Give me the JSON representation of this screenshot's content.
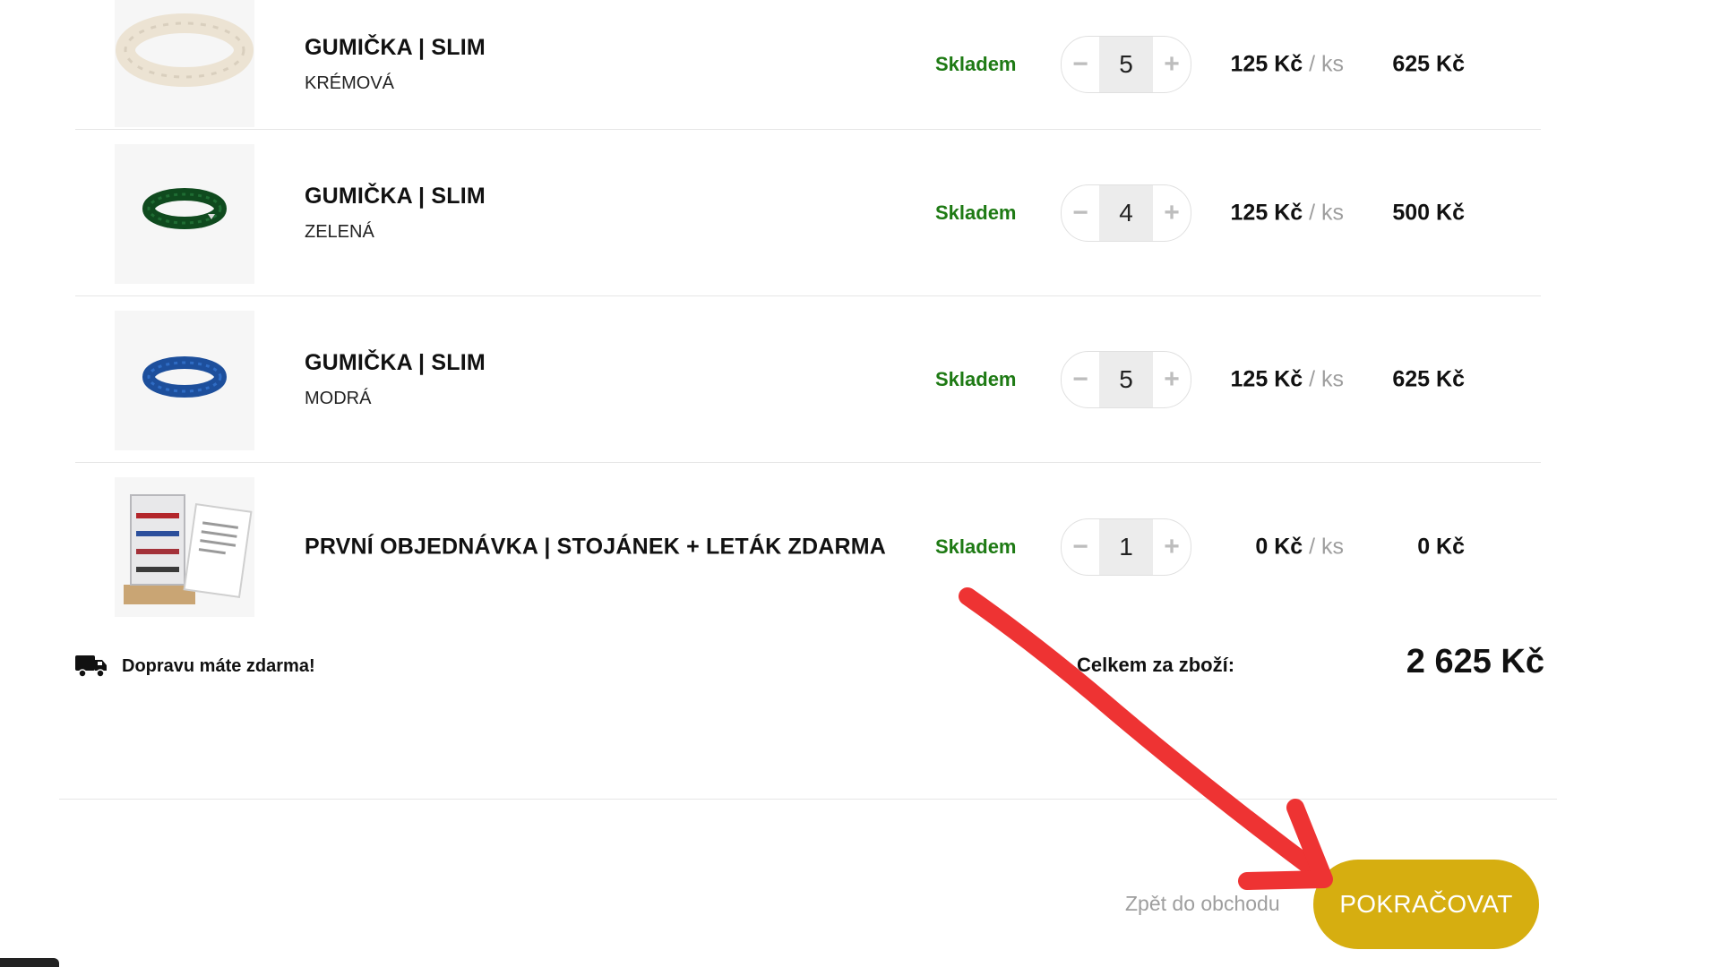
{
  "cart": {
    "items": [
      {
        "title": "GUMIČKA | SLIM",
        "variant": "KRÉMOVÁ",
        "stock": "Skladem",
        "qty": "5",
        "unit_price": "125 Kč",
        "unit_suffix": " / ks",
        "line_total": "625 Kč",
        "product_color": "#efe8dc"
      },
      {
        "title": "GUMIČKA | SLIM",
        "variant": "ZELENÁ",
        "stock": "Skladem",
        "qty": "4",
        "unit_price": "125 Kč",
        "unit_suffix": " / ks",
        "line_total": "500 Kč",
        "product_color": "#0f4a1e"
      },
      {
        "title": "GUMIČKA | SLIM",
        "variant": "MODRÁ",
        "stock": "Skladem",
        "qty": "5",
        "unit_price": "125 Kč",
        "unit_suffix": " / ks",
        "line_total": "625 Kč",
        "product_color": "#1d4f9c"
      },
      {
        "title": "PRVNÍ OBJEDNÁVKA | STOJÁNEK + LETÁK ZDARMA",
        "variant": "",
        "stock": "Skladem",
        "qty": "1",
        "unit_price": "0 Kč",
        "unit_suffix": " / ks",
        "line_total": "0 Kč",
        "product_color": "#c9a574"
      }
    ],
    "minus_symbol": "−",
    "plus_symbol": "+"
  },
  "summary": {
    "shipping_text": "Dopravu máte zdarma!",
    "shipping_icon": "truck-icon",
    "total_label": "Celkem za zboží:",
    "total_value": "2 625 Kč"
  },
  "actions": {
    "back_label": "Zpět do obchodu",
    "continue_label": "POKRAČOVAT"
  },
  "colors": {
    "accent": "#d6ae10",
    "stock": "#1e7a14",
    "annotation_arrow": "#ee3333"
  }
}
